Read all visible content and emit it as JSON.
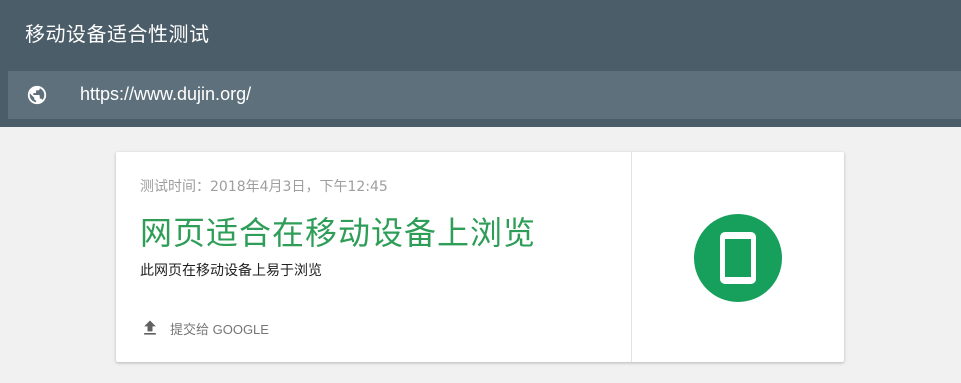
{
  "header": {
    "app_title": "移动设备适合性测试",
    "url": "https://www.dujin.org/",
    "url_icon": "globe-icon"
  },
  "result_card": {
    "test_time": "测试时间：2018年4月3日，下午12:45",
    "title": "网页适合在移动设备上浏览",
    "description": "此网页在移动设备上易于浏览",
    "submit_label": "提交给 GOOGLE",
    "submit_icon": "upload-icon",
    "status_icon": "mobile-phone-icon"
  },
  "colors": {
    "header_bg": "#4b5d69",
    "url_bar_bg": "#5e707b",
    "success_green": "#2e9d57",
    "badge_green": "#16a05c"
  }
}
